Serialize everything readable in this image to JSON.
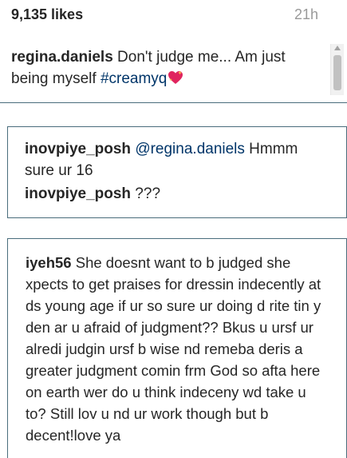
{
  "post": {
    "likes": "9,135 likes",
    "time": "21h"
  },
  "caption": {
    "username": "regina.daniels",
    "text": " Don't judge me... Am just being myself ",
    "hashtag": "#creamyq"
  },
  "comments": [
    {
      "username": "inovpiye_posh",
      "mention": "@regina.daniels",
      "text": " Hmmm sure ur 16"
    },
    {
      "username": "inovpiye_posh",
      "text": " ???"
    },
    {
      "username": "iyeh56",
      "text": " She doesnt want to b judged she xpects to get praises for dressin indecently at ds young age if ur so sure ur doing d rite tin y den ar u afraid of judgment?? Bkus u ursf ur alredi judgin ursf b wise nd remeba deris a greater judgment comin frm God so afta here on earth wer do u think indeceny wd take u to? Still lov u nd ur work though but b decent!love ya"
    }
  ],
  "icons": {
    "caption_emoji": "sparkling-heart-icon",
    "scroll_up": "chevron-up-icon"
  },
  "colors": {
    "link": "#003569",
    "text": "#262626",
    "muted": "#999999",
    "heart": "#e0245e"
  }
}
